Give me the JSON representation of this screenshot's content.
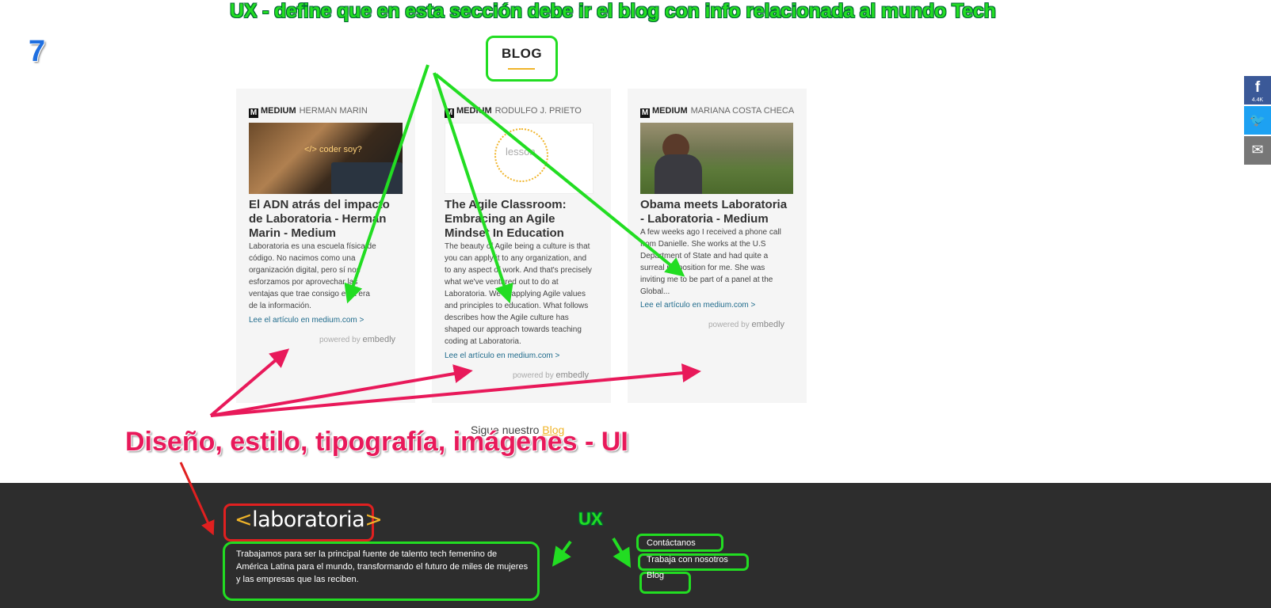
{
  "annotations": {
    "top_ux": "UX - define que en esta sección debe ir el blog con info relacionada al mundo Tech",
    "number": "7",
    "ui_label": "Diseño, estilo, tipografía, imágenes - UI",
    "ux_label": "UX"
  },
  "section": {
    "title": "BLOG"
  },
  "cards": [
    {
      "source": "MEDIUM",
      "author": "HERMAN MARIN",
      "title": "El ADN atrás del impacto de Laboratoria - Herman Marin - Medium",
      "description": "Laboratoria es una escuela física de código. No nacimos como una organización digital, pero sí nos esforzamos por aprovechar las ventajas que trae consigo esta era de la información.",
      "link": "Lee el artículo en medium.com >",
      "powered": "powered by",
      "powered_brand": "embedly",
      "image_text": "</> coder soy?"
    },
    {
      "source": "MEDIUM",
      "author": "RODULFO J. PRIETO",
      "title": "The Agile Classroom: Embracing an Agile Mindset In Education",
      "description": "The beauty of Agile being a culture is that you can apply it to any organization, and to any aspect of work. And that's precisely what we've ventured out to do at Laboratoria. We're applying Agile values and principles to education. What follows describes how the Agile culture has shaped our approach towards teaching coding at Laboratoria.",
      "link": "Lee el artículo en medium.com >",
      "powered": "powered by",
      "powered_brand": "embedly",
      "image_text": "lesson"
    },
    {
      "source": "MEDIUM",
      "author": "MARIANA COSTA CHECA",
      "title": "Obama meets Laboratoria - Laboratoria - Medium",
      "description": "A few weeks ago I received a phone call from Danielle. She works at the U.S Department of State and had quite a surreal proposition for me. She was inviting me to be part of a panel at the Global...",
      "link": "Lee el artículo en medium.com >",
      "powered": "powered by",
      "powered_brand": "embedly"
    }
  ],
  "follow": {
    "text": "Sigue nuestro ",
    "link": "Blog"
  },
  "footer": {
    "logo_open": "<",
    "logo_word": "laboratoria",
    "logo_close": ">",
    "description": "Trabajamos para ser la principal fuente de talento tech femenino de América Latina para el mundo, transformando el futuro de miles de mujeres y las empresas que las reciben.",
    "links": [
      "Contáctanos",
      "Trabaja con nosotros",
      "Blog"
    ]
  },
  "share": {
    "facebook": {
      "icon": "facebook-icon",
      "glyph": "f",
      "count": "4.4K"
    },
    "twitter": {
      "icon": "twitter-icon",
      "glyph": "🐦"
    },
    "email": {
      "icon": "email-icon",
      "glyph": "✉"
    }
  },
  "colors": {
    "green_annotation": "#22dd22",
    "pink_annotation": "#e8195a",
    "accent_yellow": "#f0b429",
    "footer_bg": "#2d2d2d",
    "link_blue": "#1f6b8c",
    "facebook": "#3b5998",
    "twitter": "#1da1f2"
  }
}
